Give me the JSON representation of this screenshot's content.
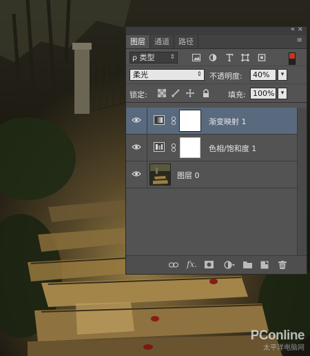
{
  "panel": {
    "tabs": [
      {
        "label": "图层",
        "active": true
      },
      {
        "label": "通道",
        "active": false
      },
      {
        "label": "路径",
        "active": false
      }
    ],
    "collapse_glyph": "«",
    "close_glyph": "×",
    "menu_glyph": "≡",
    "filter": {
      "kind_label": "类型",
      "kind_prefix": "ρ",
      "icons": [
        "image-filter-icon",
        "adjustment-filter-icon",
        "type-filter-icon",
        "shape-filter-icon",
        "smart-object-filter-icon"
      ]
    },
    "blend_mode": "柔光",
    "opacity_label": "不透明度:",
    "opacity_value": "40%",
    "lock_label": "锁定:",
    "fill_label": "填充:",
    "fill_value": "100%",
    "layers": [
      {
        "name": "渐变映射 1",
        "type": "gradient-map-adjustment",
        "selected": true,
        "visible": true
      },
      {
        "name": "色相/饱和度 1",
        "type": "hue-saturation-adjustment",
        "selected": false,
        "visible": true
      },
      {
        "name": "图层 0",
        "type": "image",
        "selected": false,
        "visible": true
      }
    ],
    "footer_icons": [
      "link-icon",
      "fx-icon",
      "add-mask-icon",
      "adjustment-icon",
      "group-icon",
      "new-layer-icon",
      "trash-icon"
    ],
    "fx_label": "fx."
  },
  "watermark": {
    "brand": "PConline",
    "tag": "太平洋电脑网"
  },
  "colors": {
    "panel_bg": "#535353",
    "selected_row": "#596a7f",
    "tab_bar": "#424242"
  }
}
